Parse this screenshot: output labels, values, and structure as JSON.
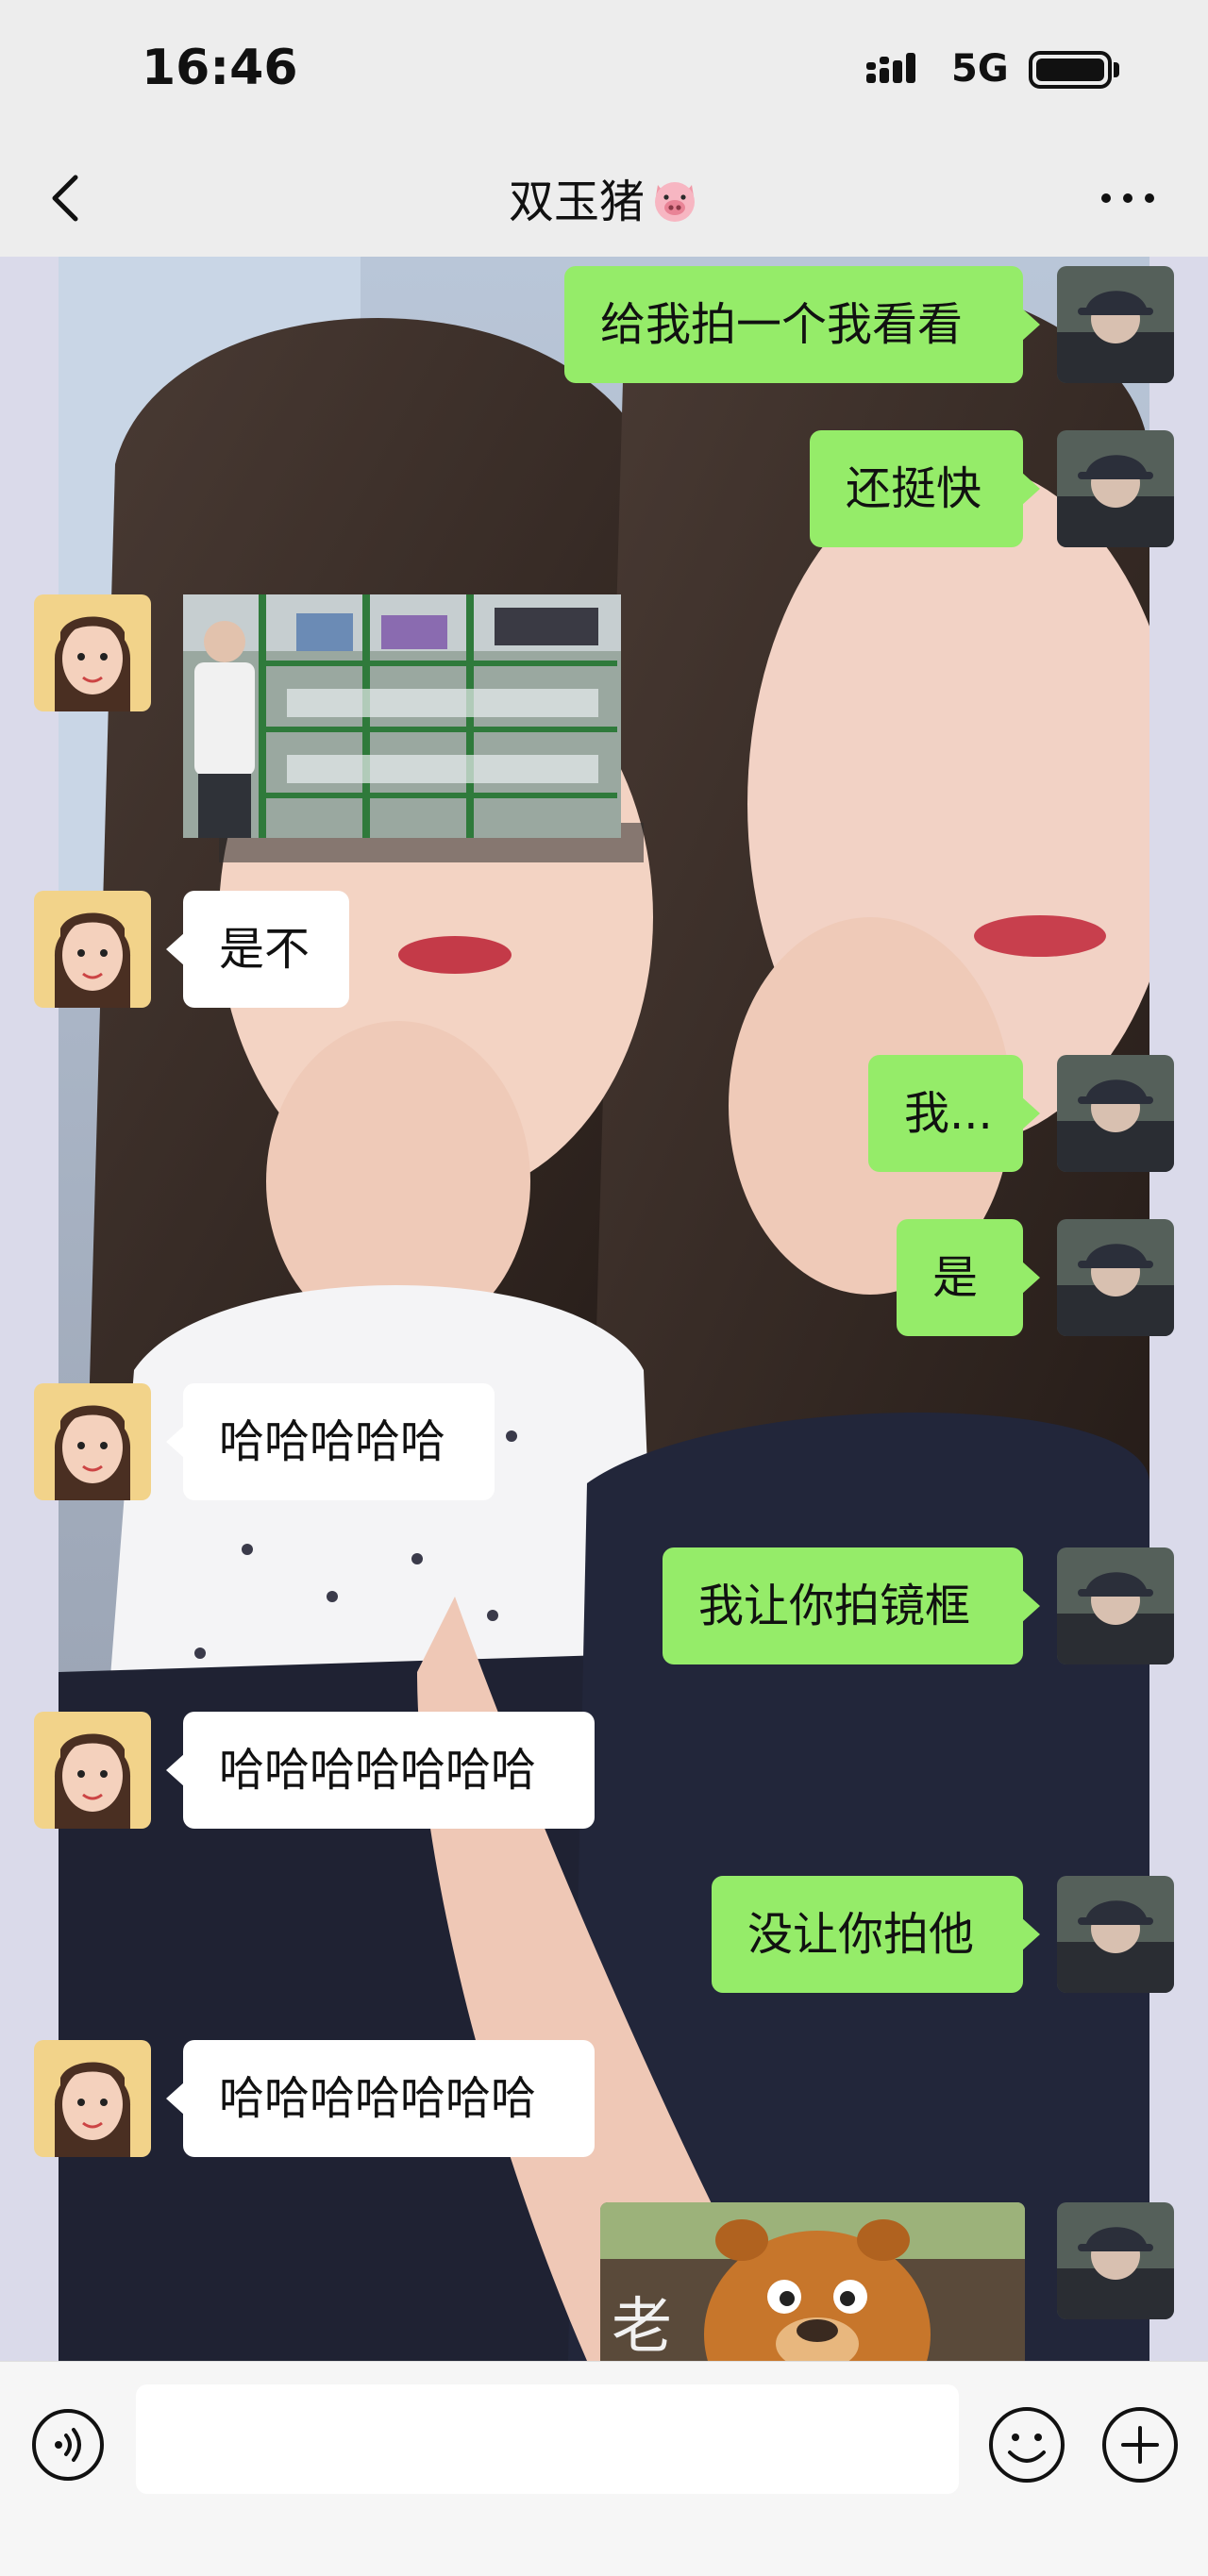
{
  "status_bar": {
    "time": "16:46",
    "network": "5G",
    "icons": [
      "signal-icon",
      "battery-icon"
    ]
  },
  "nav": {
    "title": "双玉猪",
    "icons": [
      "back-chevron-icon",
      "pig-face-icon",
      "more-dots-icon"
    ]
  },
  "chat": {
    "bubble_colors": {
      "me": "#95ec69",
      "them": "#ffffff"
    },
    "messages": [
      {
        "from": "me",
        "type": "text",
        "text": "给我拍一个我看看"
      },
      {
        "from": "me",
        "type": "text",
        "text": "还挺快"
      },
      {
        "from": "them",
        "type": "image"
      },
      {
        "from": "them",
        "type": "text",
        "text": "是不"
      },
      {
        "from": "me",
        "type": "text",
        "text": "我..."
      },
      {
        "from": "me",
        "type": "text",
        "text": "是"
      },
      {
        "from": "them",
        "type": "text",
        "text": "哈哈哈哈哈"
      },
      {
        "from": "me",
        "type": "text",
        "text": "我让你拍镜框"
      },
      {
        "from": "them",
        "type": "text",
        "text": "哈哈哈哈哈哈哈"
      },
      {
        "from": "me",
        "type": "text",
        "text": "没让你拍他"
      },
      {
        "from": "them",
        "type": "text",
        "text": "哈哈哈哈哈哈哈"
      },
      {
        "from": "me",
        "type": "sticker",
        "caption": "老"
      }
    ]
  },
  "input_bar": {
    "icons": [
      "voice-icon",
      "emoji-icon",
      "plus-icon"
    ]
  }
}
